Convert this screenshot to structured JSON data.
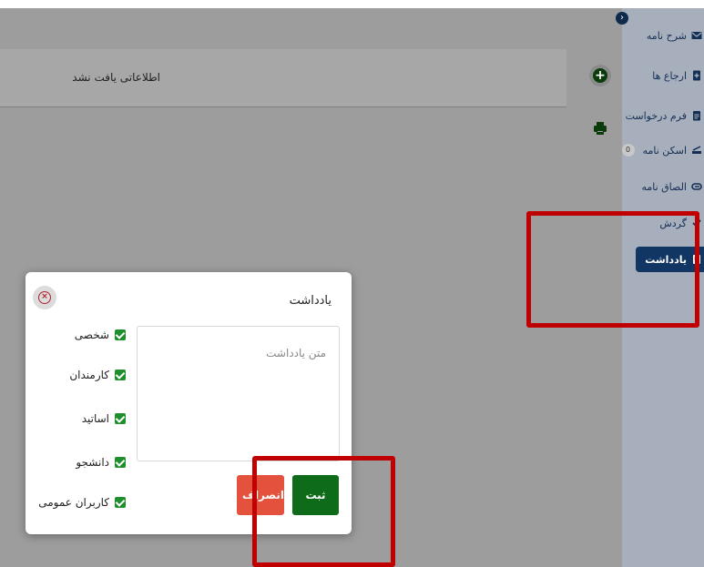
{
  "colors": {
    "accent": "#123663",
    "submit": "#0e6b19",
    "cancel": "#e4523e",
    "highlight": "#c00000",
    "checkbox": "#1f8f2e"
  },
  "main": {
    "empty_message": "اطلاعاتی یافت نشد",
    "add_icon": "plus-circle-icon",
    "print_icon": "printer-icon"
  },
  "sidebar": {
    "collapse_icon": "chevron-right-icon",
    "items": [
      {
        "label": "شرح نامه",
        "icon": "envelope-icon"
      },
      {
        "label": "ارجاع ها",
        "icon": "file-plus-icon"
      },
      {
        "label": "فرم درخواست",
        "icon": "clipboard-icon"
      },
      {
        "label": "اسکن نامه",
        "icon": "scanner-icon",
        "badge": "0"
      },
      {
        "label": "الصاق نامه",
        "icon": "paperclip-icon"
      },
      {
        "label": "گردش",
        "icon": "check-icon"
      },
      {
        "label": "یادداشت",
        "icon": "note-icon",
        "active": true
      }
    ]
  },
  "modal": {
    "title": "یادداشت",
    "close_icon": "close-circle-icon",
    "note_placeholder": "متن یادداشت",
    "checkboxes": [
      {
        "label": "شخصی",
        "checked": true
      },
      {
        "label": "کارمندان",
        "checked": true
      },
      {
        "label": "اساتید",
        "checked": true
      },
      {
        "label": "دانشجو",
        "checked": true
      },
      {
        "label": "کاربران عمومی",
        "checked": true
      }
    ],
    "submit_label": "ثبت",
    "cancel_label": "انصراف"
  }
}
